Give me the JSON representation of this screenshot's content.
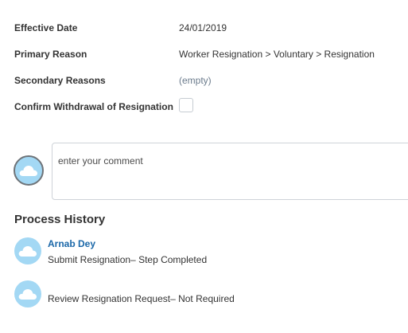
{
  "fields": {
    "effective_date": {
      "label": "Effective Date",
      "value": "24/01/2019"
    },
    "primary_reason": {
      "label": "Primary Reason",
      "value": "Worker Resignation > Voluntary > Resignation"
    },
    "secondary_reasons": {
      "label": "Secondary Reasons",
      "value": "(empty)"
    },
    "confirm_withdrawal": {
      "label": "Confirm Withdrawal of Resignation",
      "checked": false
    }
  },
  "comment": {
    "placeholder": "enter your comment",
    "avatar_icon": "cloud-icon"
  },
  "process_history": {
    "title": "Process History",
    "items": [
      {
        "name": "Arnab Dey",
        "step": "Submit Resignation– Step Completed",
        "avatar_icon": "cloud-icon"
      },
      {
        "name": "",
        "step": "Review Resignation Request– Not Required",
        "avatar_icon": "cloud-icon"
      }
    ]
  },
  "colors": {
    "avatar_bg": "#a3d8f4",
    "link": "#1a67a8",
    "empty_value": "#6b7b8c"
  }
}
